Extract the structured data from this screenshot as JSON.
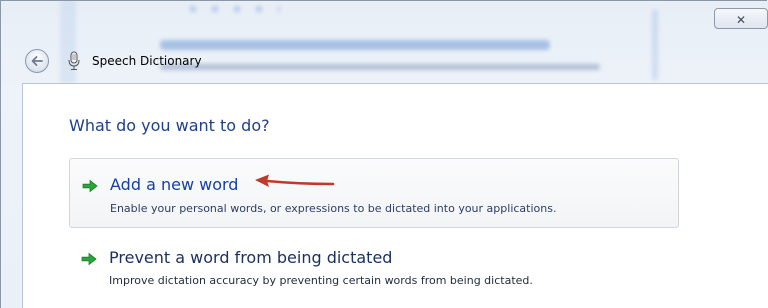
{
  "window": {
    "title": "Speech Dictionary",
    "close_symbol": "✕"
  },
  "icons": {
    "back": "back-arrow-icon",
    "microphone": "microphone-icon",
    "option_arrow": "green-right-arrow-icon",
    "annotation": "red-pointer-arrow"
  },
  "content": {
    "question": "What do you want to do?",
    "options": [
      {
        "title": "Add a new word",
        "description": "Enable your personal words, or expressions to be dictated into your applications."
      },
      {
        "title": "Prevent a word from being dictated",
        "description": "Improve dictation accuracy by preventing certain words from being dictated."
      }
    ]
  },
  "colors": {
    "link_blue": "#153fa0",
    "heading_blue": "#1e3f8a",
    "arrow_green": "#2aa53a",
    "annotation_red": "#c0392b"
  }
}
